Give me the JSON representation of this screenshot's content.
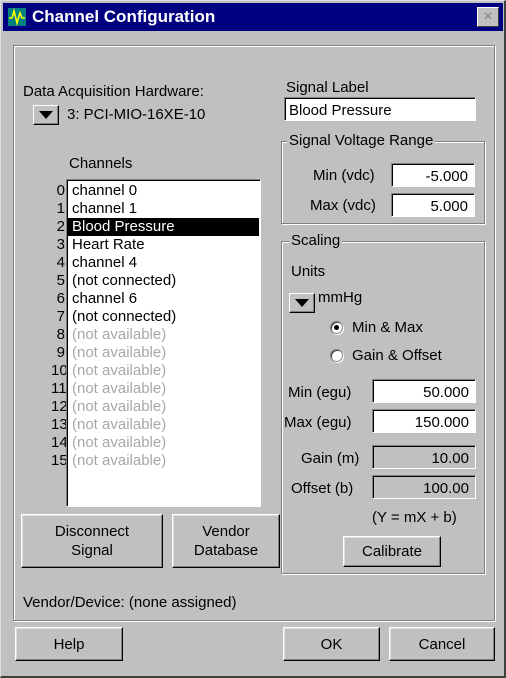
{
  "window": {
    "title": "Channel Configuration",
    "close_label": "×"
  },
  "hardware": {
    "label": "Data Acquisition Hardware:",
    "value": "3: PCI-MIO-16XE-10"
  },
  "signal": {
    "label_caption": "Signal Label",
    "label_value": "Blood Pressure"
  },
  "voltage_range": {
    "legend": "Signal Voltage Range",
    "min_label": "Min (vdc)",
    "min_value": "-5.000",
    "max_label": "Max (vdc)",
    "max_value": "5.000"
  },
  "channels": {
    "header": "Channels",
    "selected_index": 2,
    "items": [
      {
        "index": "0",
        "label": "channel 0",
        "state": "normal"
      },
      {
        "index": "1",
        "label": "channel 1",
        "state": "normal"
      },
      {
        "index": "2",
        "label": "Blood Pressure",
        "state": "selected"
      },
      {
        "index": "3",
        "label": "Heart Rate",
        "state": "normal"
      },
      {
        "index": "4",
        "label": "channel 4",
        "state": "normal"
      },
      {
        "index": "5",
        "label": "(not connected)",
        "state": "normal"
      },
      {
        "index": "6",
        "label": "channel 6",
        "state": "normal"
      },
      {
        "index": "7",
        "label": "(not connected)",
        "state": "normal"
      },
      {
        "index": "8",
        "label": "(not available)",
        "state": "disabled"
      },
      {
        "index": "9",
        "label": "(not available)",
        "state": "disabled"
      },
      {
        "index": "10",
        "label": "(not available)",
        "state": "disabled"
      },
      {
        "index": "11",
        "label": "(not available)",
        "state": "disabled"
      },
      {
        "index": "12",
        "label": "(not available)",
        "state": "disabled"
      },
      {
        "index": "13",
        "label": "(not available)",
        "state": "disabled"
      },
      {
        "index": "14",
        "label": "(not available)",
        "state": "disabled"
      },
      {
        "index": "15",
        "label": "(not available)",
        "state": "disabled"
      }
    ]
  },
  "buttons": {
    "disconnect": "Disconnect\nSignal",
    "vendor_db": "Vendor\nDatabase",
    "calibrate": "Calibrate",
    "help": "Help",
    "ok": "OK",
    "cancel": "Cancel"
  },
  "scaling": {
    "legend": "Scaling",
    "units_label": "Units",
    "units_value": "mmHg",
    "mode_selected": "minmax",
    "radio_minmax": "Min & Max",
    "radio_gain": "Gain & Offset",
    "min_egu_label": "Min (egu)",
    "min_egu_value": "50.000",
    "max_egu_label": "Max (egu)",
    "max_egu_value": "150.000",
    "gain_label": "Gain (m)",
    "gain_value": "10.00",
    "offset_label": "Offset (b)",
    "offset_value": "100.00",
    "formula": "(Y = mX + b)"
  },
  "vendor": {
    "text": "Vendor/Device:  (none assigned)"
  },
  "colors": {
    "titlebar": "#000080",
    "face": "#c0c0c0",
    "selection": "#000000",
    "disabled_text": "#a8a8a8"
  }
}
